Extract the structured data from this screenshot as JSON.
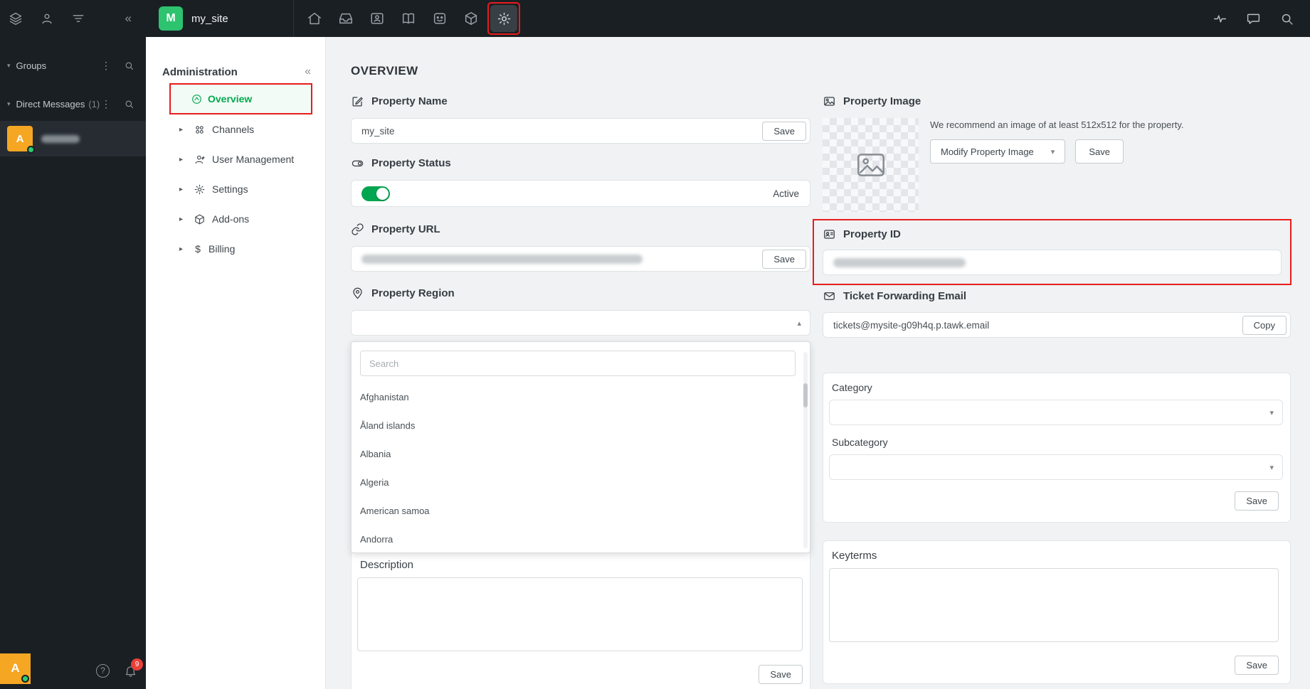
{
  "colors": {
    "accent_green": "#03a84e",
    "highlight_red": "#e81c1c",
    "dark": "#1a1f24",
    "avatar_orange": "#f5a623",
    "toggle_green": "#04a550"
  },
  "topbar": {
    "logo_letter": "M",
    "site_name": "my_site",
    "nav_icons": [
      "home",
      "inbox",
      "contacts",
      "knowledge-base",
      "chatbot",
      "apps",
      "settings"
    ],
    "active_icon": "settings",
    "right_icons": [
      "activity",
      "chat",
      "search"
    ]
  },
  "left_rail": {
    "groups_label": "Groups",
    "dm_label": "Direct Messages",
    "dm_count": "(1)",
    "dm_avatar_letter": "A",
    "user_avatar_letter": "A",
    "notification_count": "9",
    "kebab": "⋮",
    "caret": "▾",
    "collapse": "«"
  },
  "admin_sidebar": {
    "title": "Administration",
    "collapse": "«",
    "caret": "▸",
    "billing_icon": "$",
    "items": [
      {
        "label": "Overview",
        "active": true
      },
      {
        "label": "Channels"
      },
      {
        "label": "User Management"
      },
      {
        "label": "Settings"
      },
      {
        "label": "Add-ons"
      },
      {
        "label": "Billing"
      }
    ]
  },
  "main": {
    "title": "OVERVIEW",
    "property_name": {
      "label": "Property Name",
      "value": "my_site",
      "save_label": "Save"
    },
    "property_status": {
      "label": "Property Status",
      "status_text": "Active",
      "enabled": true
    },
    "property_url": {
      "label": "Property URL",
      "save_label": "Save",
      "value_redacted": true
    },
    "property_region": {
      "label": "Property Region",
      "search_placeholder": "Search",
      "open_chevron": "▴",
      "countries": [
        "Afghanistan",
        "Åland islands",
        "Albania",
        "Algeria",
        "American samoa",
        "Andorra"
      ]
    },
    "description": {
      "label": "Description",
      "save_label": "Save",
      "value": ""
    },
    "property_image": {
      "label": "Property Image",
      "hint": "We recommend an image of at least 512x512 for the property.",
      "modify_label": "Modify Property Image",
      "chevron": "▾",
      "save_label": "Save"
    },
    "property_id": {
      "label": "Property ID",
      "value_redacted": true
    },
    "ticket_email": {
      "label": "Ticket Forwarding Email",
      "value": "tickets@mysite-g09h4q.p.tawk.email",
      "copy_label": "Copy"
    },
    "category": {
      "label": "Category",
      "subcategory_label": "Subcategory",
      "chevron": "▾",
      "save_label": "Save"
    },
    "keyterms": {
      "label": "Keyterms",
      "save_label": "Save",
      "value": ""
    }
  }
}
